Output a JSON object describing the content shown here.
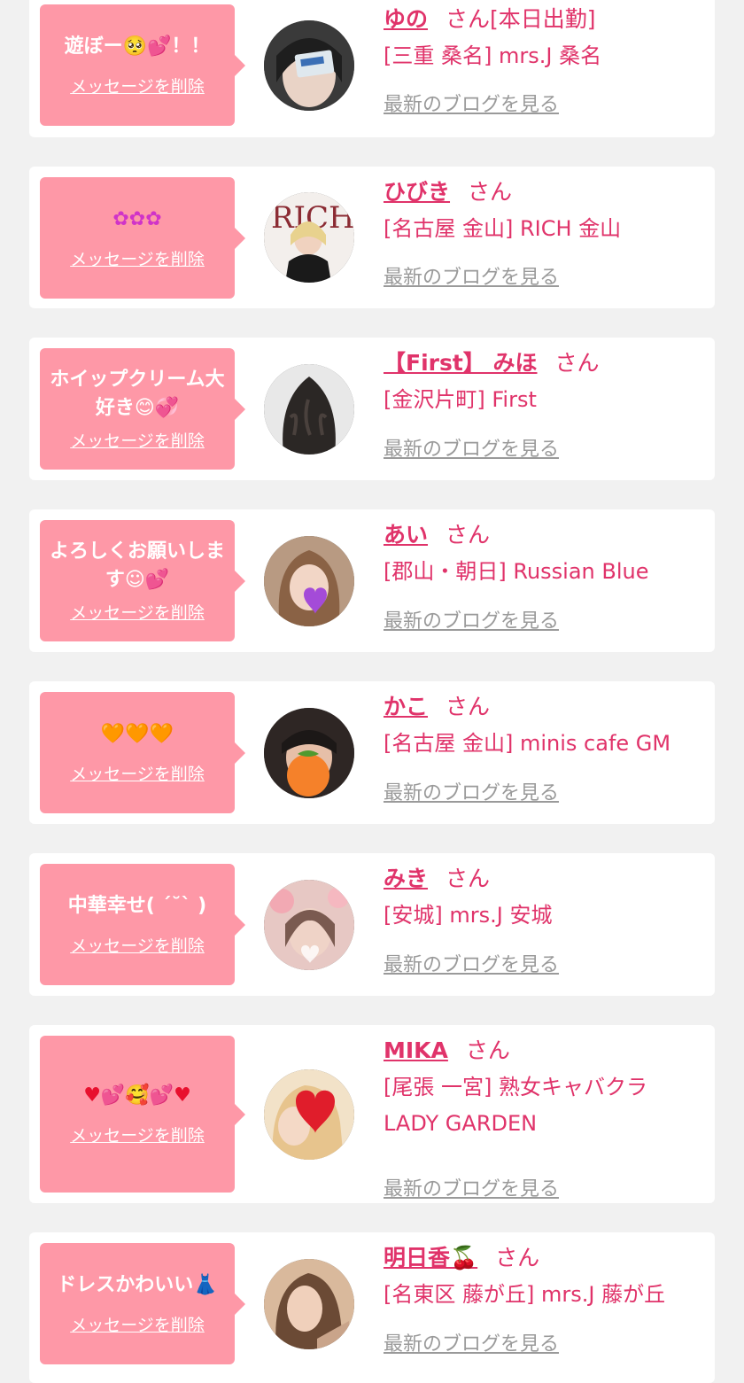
{
  "common": {
    "delete_label": "メッセージを削除",
    "blog_label": "最新のブログを見る",
    "honorific": "さん"
  },
  "entries": [
    {
      "message": "遊ぼー🥺💕！！",
      "name": "ゆの",
      "suffix": "[本日出勤]",
      "shop": "[三重 桑名] mrs.J 桑名"
    },
    {
      "message": "✿✿✿",
      "name": "ひびき",
      "suffix": "",
      "shop": "[名古屋 金山] RICH 金山"
    },
    {
      "message": "ホイップクリーム大好き😊💞",
      "name": "【First】 みほ",
      "suffix": "",
      "shop": "[金沢片町] First"
    },
    {
      "message": "よろしくお願いします☺💕",
      "name": "あい",
      "suffix": "",
      "shop": "[郡山・朝日] Russian Blue"
    },
    {
      "message": "🧡🧡🧡",
      "name": "かこ",
      "suffix": "",
      "shop": "[名古屋 金山] minis cafe GM"
    },
    {
      "message": "中華幸せ( ´˘` )",
      "name": "みき",
      "suffix": "",
      "shop": "[安城] mrs.J 安城"
    },
    {
      "message": "♥💕🥰💕♥",
      "name": "MIKA",
      "suffix": "",
      "shop": "[尾張 一宮] 熟女キャバクラ LADY GARDEN"
    },
    {
      "message": "ドレスかわいい👗",
      "name": "明日香🍒",
      "suffix": "",
      "shop": "[名東区 藤が丘] mrs.J 藤が丘"
    }
  ]
}
